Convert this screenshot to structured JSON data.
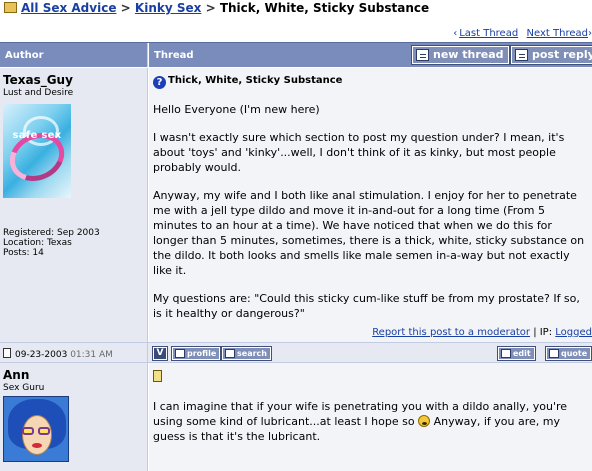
{
  "breadcrumb": {
    "items": [
      "All Sex Advice",
      "Kinky Sex"
    ],
    "separator": ">",
    "current": "Thick, White, Sticky Substance"
  },
  "thread_nav": {
    "last_thread": "Last Thread",
    "next_thread": "Next Thread"
  },
  "table_header": {
    "author": "Author",
    "thread": "Thread",
    "new_thread_button": "new thread",
    "post_reply_button": "post reply"
  },
  "post1": {
    "author": "Texas_Guy",
    "author_title": "Lust and Desire",
    "avatar_label": "safe sex",
    "registered": "Registered: Sep 2003",
    "location": "Location: Texas",
    "posts": "Posts: 14",
    "title": "Thick, White, Sticky Substance",
    "paragraphs": [
      "Hello Everyone (I'm new here)",
      "I wasn't exactly sure which section to post my question under? I mean, it's about 'toys' and 'kinky'...well, I don't think of it as kinky, but most people probably would.",
      "Anyway, my wife and I both like anal stimulation. I enjoy for her to penetrate me with a jell type dildo and move it in-and-out for a long time (From 5 minutes to an hour at a time). We have noticed that when we do this for longer than 5 minutes, sometimes, there is a thick, white, sticky substance on the dildo. It both looks and smells like male semen in-a-way but not exactly like it.",
      "My questions are: \"Could this sticky cum-like stuff be from my prostate? If so, is it healthy or dangerous?\""
    ],
    "report_link": "Report this post to a moderator",
    "ip_label": "| IP:",
    "ip_value": "Logged",
    "date": "09-23-2003",
    "time": "01:31 AM",
    "profile_button": "profile",
    "search_button": "search",
    "edit_button": "edit",
    "quote_button": "quote",
    "v_button": "V"
  },
  "post2": {
    "author": "Ann",
    "author_title": "Sex Guru",
    "text_before_smiley": "I can imagine that if your wife is penetrating you with a dildo anally, you're using some kind of lubricant...at least I hope so",
    "text_after_smiley": "Anyway, if you are, my guess is that it's the lubricant."
  },
  "colors": {
    "header_bg": "#7a8cbc",
    "author_cell_bg": "#e6e9f2",
    "body_cell_bg": "#f2f4f8",
    "link": "#1a3fa3"
  }
}
